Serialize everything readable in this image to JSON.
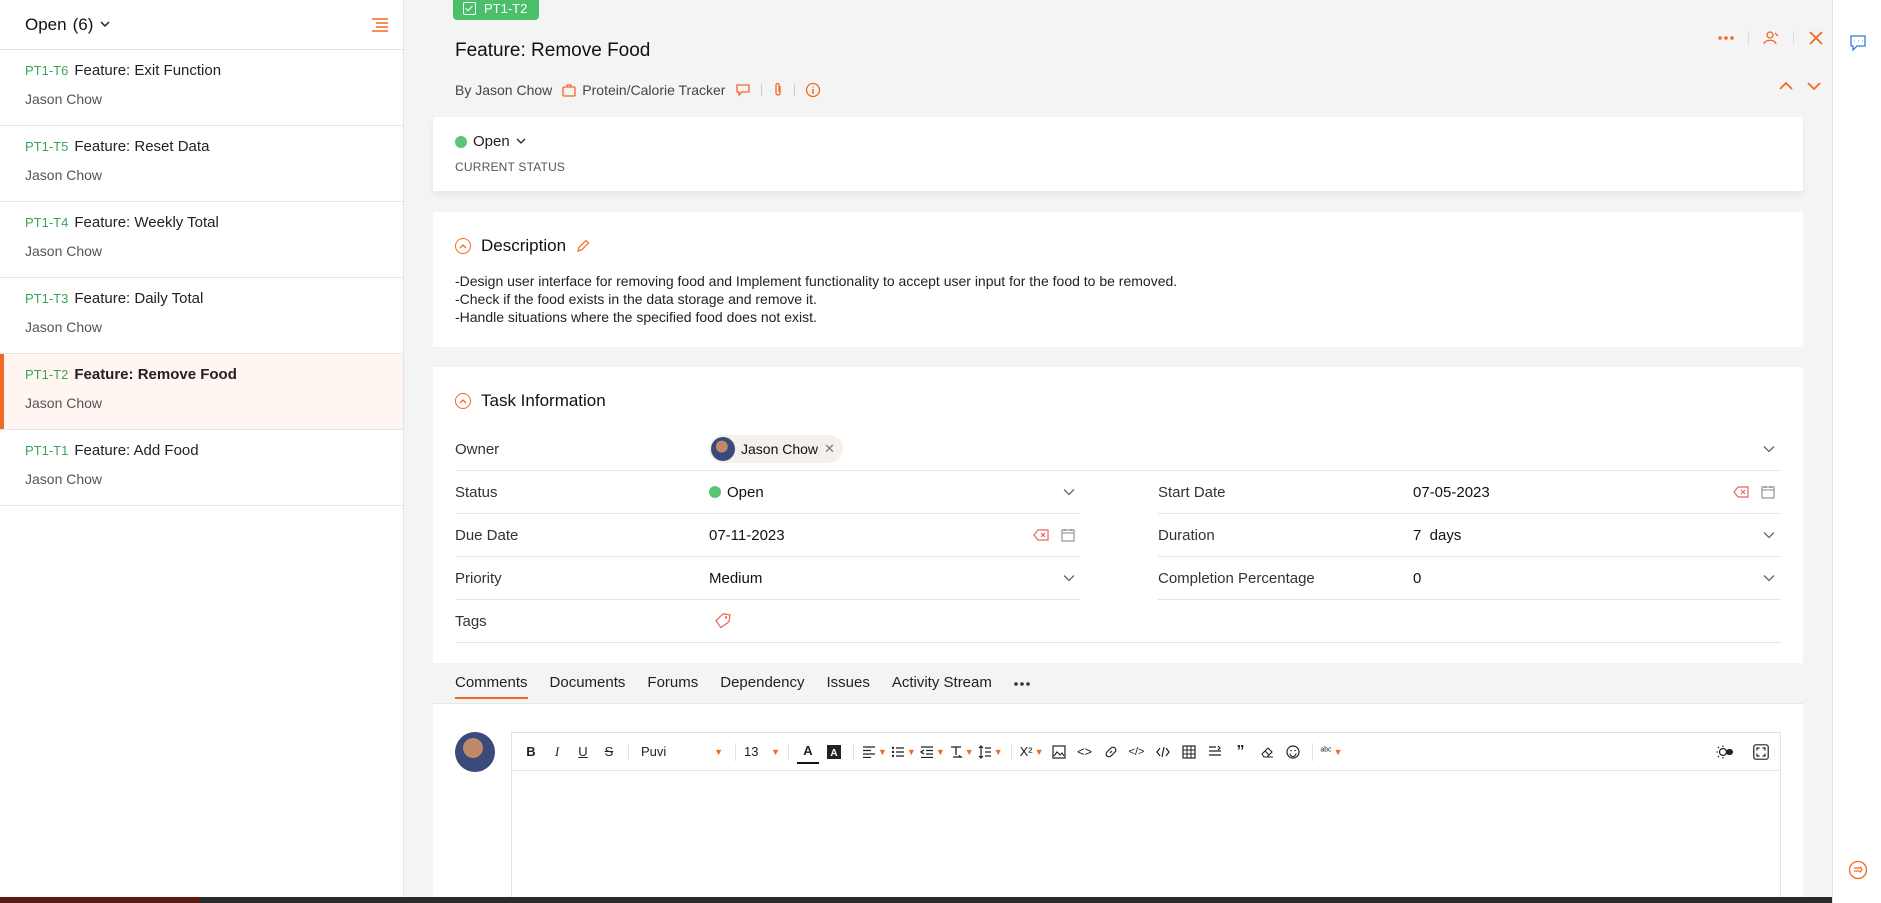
{
  "list": {
    "header": "Open",
    "count": "(6)",
    "items": [
      {
        "id": "PT1-T6",
        "name": "Feature: Exit Function",
        "owner": "Jason Chow"
      },
      {
        "id": "PT1-T5",
        "name": "Feature: Reset Data",
        "owner": "Jason Chow"
      },
      {
        "id": "PT1-T4",
        "name": "Feature: Weekly Total",
        "owner": "Jason Chow"
      },
      {
        "id": "PT1-T3",
        "name": "Feature: Daily Total",
        "owner": "Jason Chow"
      },
      {
        "id": "PT1-T2",
        "name": "Feature: Remove Food",
        "owner": "Jason Chow"
      },
      {
        "id": "PT1-T1",
        "name": "Feature: Add Food",
        "owner": "Jason Chow"
      }
    ]
  },
  "task": {
    "id": "PT1-T2",
    "title": "Feature: Remove Food",
    "by": "By Jason Chow",
    "project": "Protein/Calorie Tracker",
    "status": "Open",
    "status_caption": "CURRENT STATUS"
  },
  "description": {
    "heading": "Description",
    "lines": [
      "-Design user interface for removing food and Implement functionality to accept user input for the food to be removed.",
      "-Check if the food exists in the data storage and remove it.",
      "-Handle situations where the specified food does not exist."
    ]
  },
  "info": {
    "heading": "Task Information",
    "owner_label": "Owner",
    "owner_value": "Jason Chow",
    "status_label": "Status",
    "status_value": "Open",
    "start_label": "Start Date",
    "start_value": "07-05-2023",
    "due_label": "Due Date",
    "due_value": "07-11-2023",
    "duration_label": "Duration",
    "duration_value": "7  days",
    "priority_label": "Priority",
    "priority_value": "Medium",
    "completion_label": "Completion Percentage",
    "completion_value": "0",
    "tags_label": "Tags"
  },
  "tabs": [
    "Comments",
    "Documents",
    "Forums",
    "Dependency",
    "Issues",
    "Activity Stream"
  ],
  "editor": {
    "font": "Puvi",
    "size": "13"
  },
  "colors": {
    "accent": "#f06a25",
    "status_green": "#5cc476",
    "badge_green": "#4cbf6b",
    "id_green": "#3aa457"
  }
}
